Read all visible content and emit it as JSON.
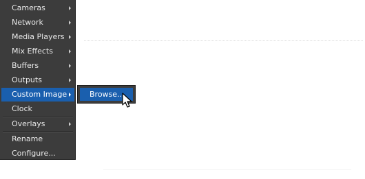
{
  "context_menu": {
    "items": [
      {
        "label": "Cameras",
        "has_submenu": true
      },
      {
        "label": "Network",
        "has_submenu": true
      },
      {
        "label": "Media Players",
        "has_submenu": true
      },
      {
        "label": "Mix Effects",
        "has_submenu": true
      },
      {
        "label": "Buffers",
        "has_submenu": true
      },
      {
        "label": "Outputs",
        "has_submenu": true
      },
      {
        "label": "Custom Image",
        "has_submenu": true,
        "selected": true
      },
      {
        "label": "Clock",
        "has_submenu": false
      },
      {
        "label": "Overlays",
        "has_submenu": true
      },
      {
        "label": "Rename",
        "has_submenu": false
      },
      {
        "label": "Configure...",
        "has_submenu": false
      }
    ]
  },
  "submenu": {
    "items": [
      {
        "label": "Browse...",
        "selected": true
      }
    ]
  },
  "colors": {
    "menu_background": "#3c3c3c",
    "highlight": "#1a5fae",
    "menu_text": "#e9e9e9"
  },
  "icons": {
    "submenu_indicator": "chevron-right-icon",
    "pointer": "mouse-cursor-icon"
  }
}
